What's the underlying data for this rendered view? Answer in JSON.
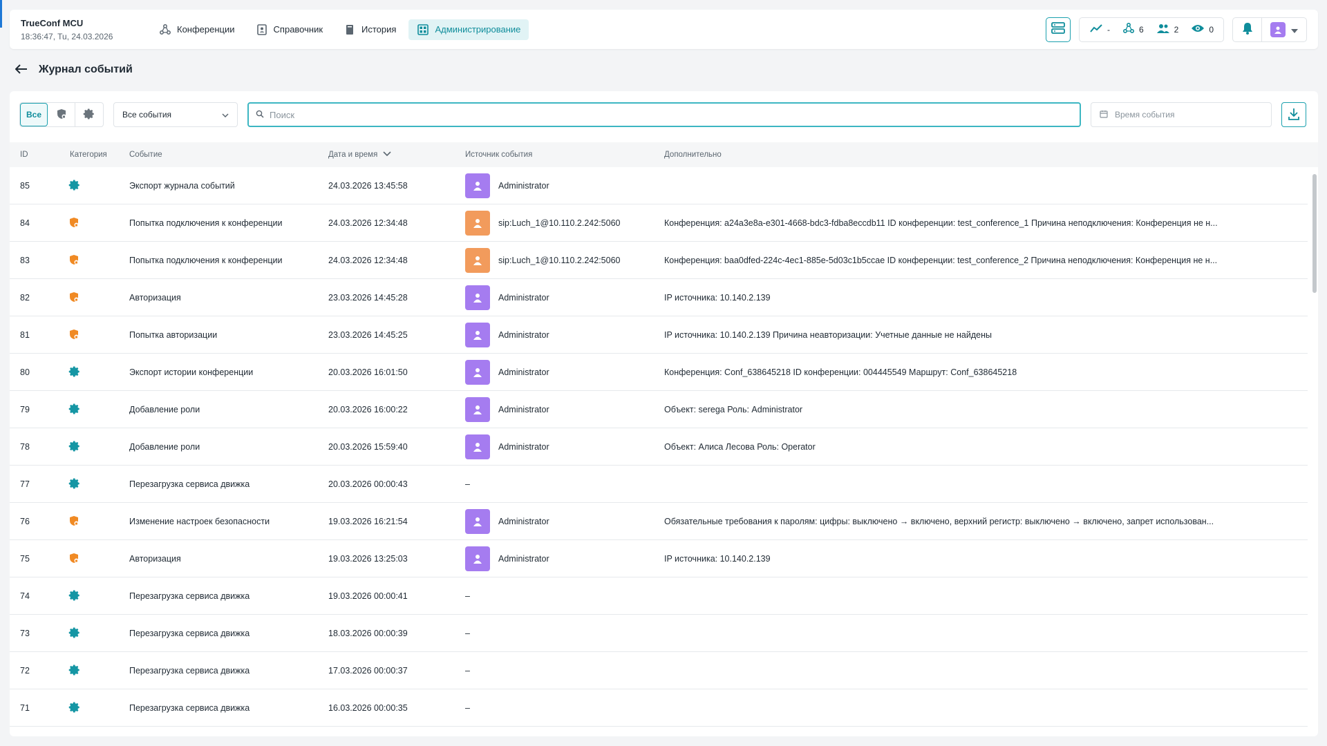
{
  "header": {
    "app_title": "TrueConf MCU",
    "datetime": "18:36:47, Tu, 24.03.2026",
    "nav": [
      {
        "label": "Конференции",
        "icon": "conferences-icon",
        "active": false
      },
      {
        "label": "Справочник",
        "icon": "directory-icon",
        "active": false
      },
      {
        "label": "История",
        "icon": "history-icon",
        "active": false
      },
      {
        "label": "Администрирование",
        "icon": "administration-icon",
        "active": true
      }
    ],
    "stats": {
      "load": "-",
      "conferences": "6",
      "participants": "2",
      "viewers": "0"
    }
  },
  "page": {
    "title": "Журнал событий"
  },
  "toolbar": {
    "filter_all_label": "Все",
    "event_select_value": "Все события",
    "search_placeholder": "Поиск",
    "date_placeholder": "Время события"
  },
  "table": {
    "columns": {
      "id": "ID",
      "category": "Категория",
      "event": "Событие",
      "datetime": "Дата и время",
      "source": "Источник события",
      "extra": "Дополнительно"
    },
    "rows": [
      {
        "id": "85",
        "category": "system",
        "event": "Экспорт журнала событий",
        "datetime": "24.03.2026 13:45:58",
        "source": "Administrator",
        "source_type": "admin",
        "extra": ""
      },
      {
        "id": "84",
        "category": "security",
        "event": "Попытка подключения к конференции",
        "datetime": "24.03.2026 12:34:48",
        "source": "sip:Luch_1@10.110.2.242:5060",
        "source_type": "sip",
        "extra": "Конференция: a24a3e8a-e301-4668-bdc3-fdba8eccdb11   ID конференции: test_conference_1   Причина неподключения: Конференция не н..."
      },
      {
        "id": "83",
        "category": "security",
        "event": "Попытка подключения к конференции",
        "datetime": "24.03.2026 12:34:48",
        "source": "sip:Luch_1@10.110.2.242:5060",
        "source_type": "sip",
        "extra": "Конференция: baa0dfed-224c-4ec1-885e-5d03c1b5ccae   ID конференции: test_conference_2   Причина неподключения: Конференция не н..."
      },
      {
        "id": "82",
        "category": "security",
        "event": "Авторизация",
        "datetime": "23.03.2026 14:45:28",
        "source": "Administrator",
        "source_type": "admin",
        "extra": "IP источника: 10.140.2.139"
      },
      {
        "id": "81",
        "category": "security",
        "event": "Попытка авторизации",
        "datetime": "23.03.2026 14:45:25",
        "source": "Administrator",
        "source_type": "admin",
        "extra": "IP источника: 10.140.2.139   Причина неавторизации: Учетные данные не найдены"
      },
      {
        "id": "80",
        "category": "system",
        "event": "Экспорт истории конференции",
        "datetime": "20.03.2026 16:01:50",
        "source": "Administrator",
        "source_type": "admin",
        "extra": "Конференция: Conf_638645218   ID конференции: 004445549   Маршрут: Conf_638645218"
      },
      {
        "id": "79",
        "category": "system",
        "event": "Добавление роли",
        "datetime": "20.03.2026 16:00:22",
        "source": "Administrator",
        "source_type": "admin",
        "extra": "Объект: serega   Роль: Administrator"
      },
      {
        "id": "78",
        "category": "system",
        "event": "Добавление роли",
        "datetime": "20.03.2026 15:59:40",
        "source": "Administrator",
        "source_type": "admin",
        "extra": "Объект: Алиса Лесова   Роль: Operator"
      },
      {
        "id": "77",
        "category": "system",
        "event": "Перезагрузка сервиса движка",
        "datetime": "20.03.2026 00:00:43",
        "source": "–",
        "source_type": "none",
        "extra": ""
      },
      {
        "id": "76",
        "category": "security",
        "event": "Изменение настроек безопасности",
        "datetime": "19.03.2026 16:21:54",
        "source": "Administrator",
        "source_type": "admin",
        "extra": "Обязательные требования к паролям: цифры: выключено → включено, верхний регистр: выключено → включено, запрет использован..."
      },
      {
        "id": "75",
        "category": "security",
        "event": "Авторизация",
        "datetime": "19.03.2026 13:25:03",
        "source": "Administrator",
        "source_type": "admin",
        "extra": "IP источника: 10.140.2.139"
      },
      {
        "id": "74",
        "category": "system",
        "event": "Перезагрузка сервиса движка",
        "datetime": "19.03.2026 00:00:41",
        "source": "–",
        "source_type": "none",
        "extra": ""
      },
      {
        "id": "73",
        "category": "system",
        "event": "Перезагрузка сервиса движка",
        "datetime": "18.03.2026 00:00:39",
        "source": "–",
        "source_type": "none",
        "extra": ""
      },
      {
        "id": "72",
        "category": "system",
        "event": "Перезагрузка сервиса движка",
        "datetime": "17.03.2026 00:00:37",
        "source": "–",
        "source_type": "none",
        "extra": ""
      },
      {
        "id": "71",
        "category": "system",
        "event": "Перезагрузка сервиса движка",
        "datetime": "16.03.2026 00:00:35",
        "source": "–",
        "source_type": "none",
        "extra": ""
      }
    ]
  },
  "colors": {
    "accent": "#1aa0ae",
    "security": "#f08a24",
    "admin_avatar": "#a57cf0",
    "sip_avatar": "#f29b5c"
  }
}
